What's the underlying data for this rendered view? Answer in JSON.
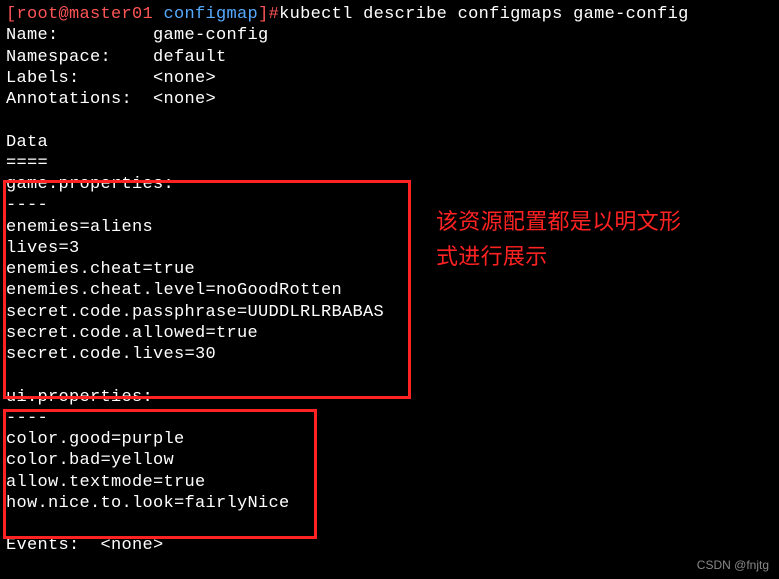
{
  "prompt": {
    "open_bracket": "[",
    "user_host": "root@master01 ",
    "dir": "configmap",
    "close_bracket": "]",
    "hash": "#",
    "command": "kubectl describe configmaps game-config"
  },
  "meta": {
    "name_label": "Name:",
    "name_value": "game-config",
    "namespace_label": "Namespace:",
    "namespace_value": "default",
    "labels_label": "Labels:",
    "labels_value": "<none>",
    "annotations_label": "Annotations:",
    "annotations_value": "<none>"
  },
  "data_header": {
    "title": "Data",
    "separator": "===="
  },
  "game_properties": {
    "header": "game.properties:",
    "sep": "----",
    "lines": [
      "enemies=aliens",
      "lives=3",
      "enemies.cheat=true",
      "enemies.cheat.level=noGoodRotten",
      "secret.code.passphrase=UUDDLRLRBABAS",
      "secret.code.allowed=true",
      "secret.code.lives=30"
    ]
  },
  "ui_properties": {
    "header": "ui.properties:",
    "sep": "----",
    "lines": [
      "color.good=purple",
      "color.bad=yellow",
      "allow.textmode=true",
      "how.nice.to.look=fairlyNice"
    ]
  },
  "events": {
    "label": "Events:",
    "value": "<none>"
  },
  "annotation": {
    "line1": "该资源配置都是以明文形",
    "line2": "式进行展示"
  },
  "watermark": "CSDN @fnjtg"
}
